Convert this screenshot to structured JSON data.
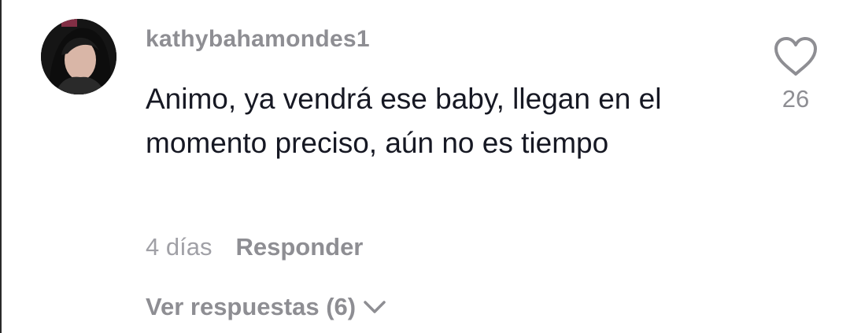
{
  "comment": {
    "username": "kathybahamondes1",
    "text": "Animo, ya vendrá ese baby, llegan en el momento preciso, aún no es tiempo",
    "time_ago": "4 días",
    "reply_label": "Responder",
    "view_replies_label": "Ver respuestas (6)",
    "like_count": "26"
  },
  "icons": {
    "like": "heart-outline-icon",
    "expand": "chevron-down-icon",
    "avatar": "user-avatar"
  },
  "colors": {
    "text": "#161823",
    "secondary": "#8e8e93"
  }
}
